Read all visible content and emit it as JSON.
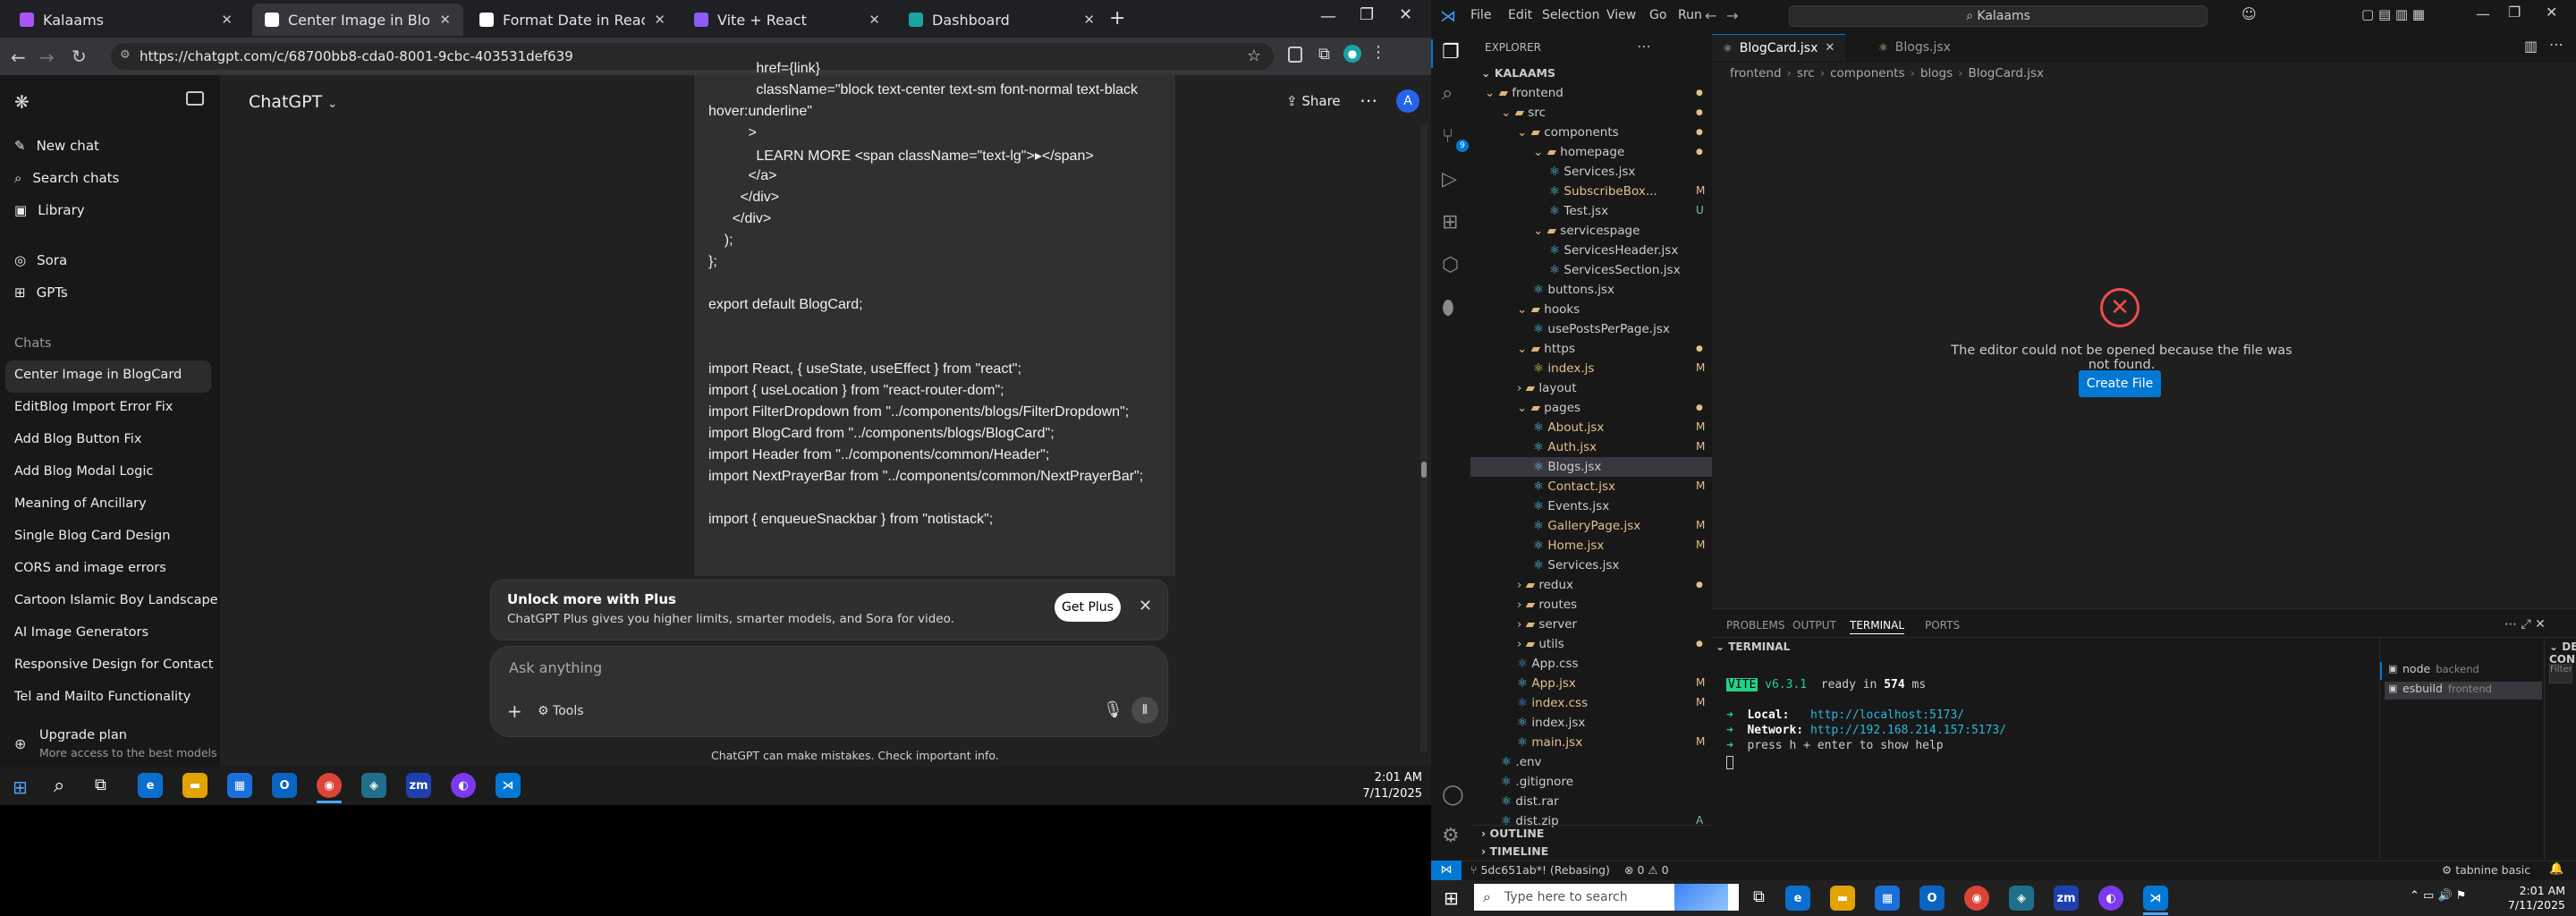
{
  "browser": {
    "tabs": [
      {
        "title": "Kalaams",
        "color": "#a855f7"
      },
      {
        "title": "Center Image in BlogCard",
        "color": "#ffffff"
      },
      {
        "title": "Format Date in React Compone",
        "color": "#ffffff"
      },
      {
        "title": "Vite + React",
        "color": "#8b5cf6"
      },
      {
        "title": "Dashboard",
        "color": "#1aa3a3"
      }
    ],
    "new_tab": "+",
    "url": "https://chatgpt.com/c/68700bb8-cda0-8001-9cbc-403531def639"
  },
  "chatgpt": {
    "model": "ChatGPT",
    "share": "Share",
    "avatar": "A",
    "nav": {
      "new_chat": "New chat",
      "search": "Search chats",
      "library": "Library",
      "sora": "Sora",
      "gpts": "GPTs"
    },
    "chats_heading": "Chats",
    "history": [
      "Center Image in BlogCard",
      "EditBlog Import Error Fix",
      "Add Blog Button Fix",
      "Add Blog Modal Logic",
      "Meaning of Ancillary",
      "Single Blog Card Design",
      "CORS and image errors",
      "Cartoon Islamic Boy Landscape",
      "AI Image Generators",
      "Responsive Design for Contact",
      "Tel and Mailto Functionality"
    ],
    "upgrade_title": "Upgrade plan",
    "upgrade_sub": "More access to the best models",
    "code_lines": [
      "            href={link}",
      "            className=\"block text-center text-sm font-normal text-black",
      "hover:underline\"",
      "          >",
      "            LEARN MORE <span className=\"text-lg\">▸</span>",
      "          </a>",
      "        </div>",
      "      </div>",
      "    );",
      "};",
      "",
      "export default BlogCard;",
      "",
      "",
      "import React, { useState, useEffect } from \"react\";",
      "import { useLocation } from \"react-router-dom\";",
      "import FilterDropdown from \"../components/blogs/FilterDropdown\";",
      "import BlogCard from \"../components/blogs/BlogCard\";",
      "import Header from \"../components/common/Header\";",
      "import NextPrayerBar from \"../components/common/NextPrayerBar\";",
      "",
      "import { enqueueSnackbar } from \"notistack\";"
    ],
    "banner_title": "Unlock more with Plus",
    "banner_sub": "ChatGPT Plus gives you higher limits, smarter models, and Sora for video.",
    "banner_button": "Get Plus",
    "placeholder": "Ask anything",
    "tools": "Tools",
    "disclaimer": "ChatGPT can make mistakes. Check important info."
  },
  "left_taskbar": {
    "time": "2:01 AM",
    "date": "7/11/2025",
    "zm": "zm"
  },
  "vscode": {
    "menu": [
      "File",
      "Edit",
      "Selection",
      "View",
      "Go",
      "Run"
    ],
    "search": "Kalaams",
    "explorer_title": "EXPLORER",
    "root": "KALAAMS",
    "tree": [
      {
        "label": "frontend",
        "depth": 0,
        "kind": "folder",
        "open": true,
        "status": "dot"
      },
      {
        "label": "src",
        "depth": 1,
        "kind": "folder",
        "open": true,
        "status": "dot"
      },
      {
        "label": "components",
        "depth": 2,
        "kind": "folder",
        "open": true,
        "status": "dot"
      },
      {
        "label": "homepage",
        "depth": 3,
        "kind": "folder",
        "open": true,
        "status": "dot"
      },
      {
        "label": "Services.jsx",
        "depth": 4,
        "kind": "file",
        "status": ""
      },
      {
        "label": "SubscribeBox...",
        "depth": 4,
        "kind": "file",
        "status": "M"
      },
      {
        "label": "Test.jsx",
        "depth": 4,
        "kind": "file",
        "status": "U"
      },
      {
        "label": "servicespage",
        "depth": 3,
        "kind": "folder",
        "open": true,
        "status": ""
      },
      {
        "label": "ServicesHeader.jsx",
        "depth": 4,
        "kind": "file",
        "status": ""
      },
      {
        "label": "ServicesSection.jsx",
        "depth": 4,
        "kind": "file",
        "status": ""
      },
      {
        "label": "buttons.jsx",
        "depth": 3,
        "kind": "file",
        "status": ""
      },
      {
        "label": "hooks",
        "depth": 2,
        "kind": "folder",
        "open": true,
        "status": ""
      },
      {
        "label": "usePostsPerPage.jsx",
        "depth": 3,
        "kind": "file",
        "status": ""
      },
      {
        "label": "https",
        "depth": 2,
        "kind": "folder",
        "open": true,
        "status": "dot"
      },
      {
        "label": "index.js",
        "depth": 3,
        "kind": "file",
        "status": "M"
      },
      {
        "label": "layout",
        "depth": 2,
        "kind": "folder",
        "open": false,
        "status": ""
      },
      {
        "label": "pages",
        "depth": 2,
        "kind": "folder",
        "open": true,
        "status": "dot"
      },
      {
        "label": "About.jsx",
        "depth": 3,
        "kind": "file",
        "status": "M"
      },
      {
        "label": "Auth.jsx",
        "depth": 3,
        "kind": "file",
        "status": "M"
      },
      {
        "label": "Blogs.jsx",
        "depth": 3,
        "kind": "file",
        "status": "",
        "selected": true
      },
      {
        "label": "Contact.jsx",
        "depth": 3,
        "kind": "file",
        "status": "M"
      },
      {
        "label": "Events.jsx",
        "depth": 3,
        "kind": "file",
        "status": ""
      },
      {
        "label": "GalleryPage.jsx",
        "depth": 3,
        "kind": "file",
        "status": "M"
      },
      {
        "label": "Home.jsx",
        "depth": 3,
        "kind": "file",
        "status": "M"
      },
      {
        "label": "Services.jsx",
        "depth": 3,
        "kind": "file",
        "status": ""
      },
      {
        "label": "redux",
        "depth": 2,
        "kind": "folder",
        "open": false,
        "status": "dot"
      },
      {
        "label": "routes",
        "depth": 2,
        "kind": "folder",
        "open": false,
        "status": ""
      },
      {
        "label": "server",
        "depth": 2,
        "kind": "folder",
        "open": false,
        "status": ""
      },
      {
        "label": "utils",
        "depth": 2,
        "kind": "folder",
        "open": false,
        "status": "dot"
      },
      {
        "label": "App.css",
        "depth": 2,
        "kind": "file",
        "status": ""
      },
      {
        "label": "App.jsx",
        "depth": 2,
        "kind": "file",
        "status": "M"
      },
      {
        "label": "index.css",
        "depth": 2,
        "kind": "file",
        "status": "M"
      },
      {
        "label": "index.jsx",
        "depth": 2,
        "kind": "file",
        "status": ""
      },
      {
        "label": "main.jsx",
        "depth": 2,
        "kind": "file",
        "status": "M"
      },
      {
        "label": ".env",
        "depth": 1,
        "kind": "file",
        "status": ""
      },
      {
        "label": ".gitignore",
        "depth": 1,
        "kind": "file",
        "status": ""
      },
      {
        "label": "dist.rar",
        "depth": 1,
        "kind": "file",
        "status": ""
      },
      {
        "label": "dist.zip",
        "depth": 1,
        "kind": "file",
        "status": "A"
      }
    ],
    "outline": "OUTLINE",
    "timeline": "TIMELINE",
    "tabs": [
      {
        "label": "BlogCard.jsx",
        "active": true
      },
      {
        "label": "Blogs.jsx",
        "active": false
      }
    ],
    "breadcrumb": [
      "frontend",
      "src",
      "components",
      "blogs",
      "BlogCard.jsx"
    ],
    "error_text": "The editor could not be opened because the file was not found.",
    "create_file": "Create File",
    "panel_tabs": [
      "PROBLEMS",
      "OUTPUT",
      "TERMINAL",
      "PORTS"
    ],
    "terminal_title": "TERMINAL",
    "debug_title": "DEBUG CONSOLE",
    "debug_filter": "Filter (e.g. text, !exclude, \\...",
    "terminals": [
      {
        "name": "node",
        "sub": "backend"
      },
      {
        "name": "esbuild",
        "sub": "frontend"
      }
    ],
    "terminal": {
      "vite": "VITE",
      "version": "v6.3.1",
      "ready": "ready in",
      "ms": "574",
      "ms_unit": "ms",
      "local_label": "Local:",
      "local_url": "http://localhost:5173/",
      "network_label": "Network:",
      "network_url": "http://192.168.214.157:5173/",
      "help": "press h + enter to show help"
    },
    "status": {
      "branch": "5dc651ab*! (Rebasing)",
      "errors": "0",
      "warnings": "0",
      "tabnine": "tabnine basic"
    },
    "taskbar": {
      "search": "Type here to search",
      "time": "2:01 AM",
      "date": "7/11/2025",
      "zm": "zm"
    }
  },
  "colors": {
    "accent": "#0078d4",
    "modified": "#e2c08d",
    "error": "#f14c4c",
    "terminal_green": "#23d18b",
    "terminal_cyan": "#3b8eea"
  }
}
